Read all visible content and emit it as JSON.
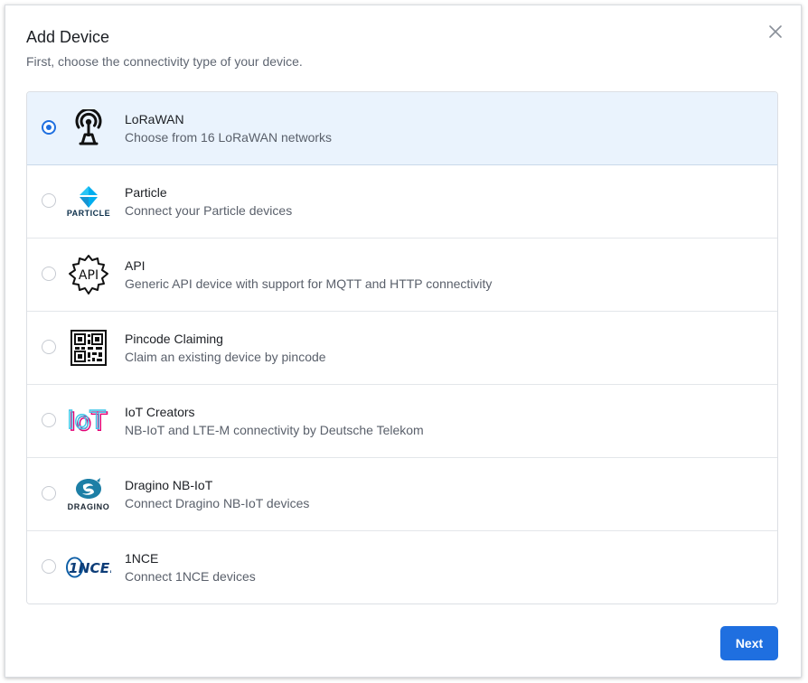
{
  "dialog": {
    "title": "Add Device",
    "subtitle": "First, choose the connectivity type of your device.",
    "next_label": "Next"
  },
  "options": [
    {
      "title": "LoRaWAN",
      "description": "Choose from 16 LoRaWAN networks",
      "selected": true,
      "icon": "lorawan-tower-icon"
    },
    {
      "title": "Particle",
      "description": "Connect your Particle devices",
      "selected": false,
      "icon": "particle-logo",
      "logo_text": "PARTICLE"
    },
    {
      "title": "API",
      "description": "Generic API device with support for MQTT and HTTP connectivity",
      "selected": false,
      "icon": "api-gear-icon",
      "logo_text": "API"
    },
    {
      "title": "Pincode Claiming",
      "description": "Claim an existing device by pincode",
      "selected": false,
      "icon": "qr-code-icon"
    },
    {
      "title": "IoT Creators",
      "description": "NB-IoT and LTE-M connectivity by Deutsche Telekom",
      "selected": false,
      "icon": "iot-creators-logo",
      "logo_text": "IoT"
    },
    {
      "title": "Dragino NB-IoT",
      "description": "Connect Dragino NB-IoT devices",
      "selected": false,
      "icon": "dragino-logo",
      "logo_text": "DRAGINO"
    },
    {
      "title": "1NCE",
      "description": "Connect 1NCE devices",
      "selected": false,
      "icon": "1nce-logo",
      "logo_text": "1NCE."
    }
  ],
  "colors": {
    "accent": "#1f6fe0",
    "selected_row": "#eaf3fd"
  }
}
